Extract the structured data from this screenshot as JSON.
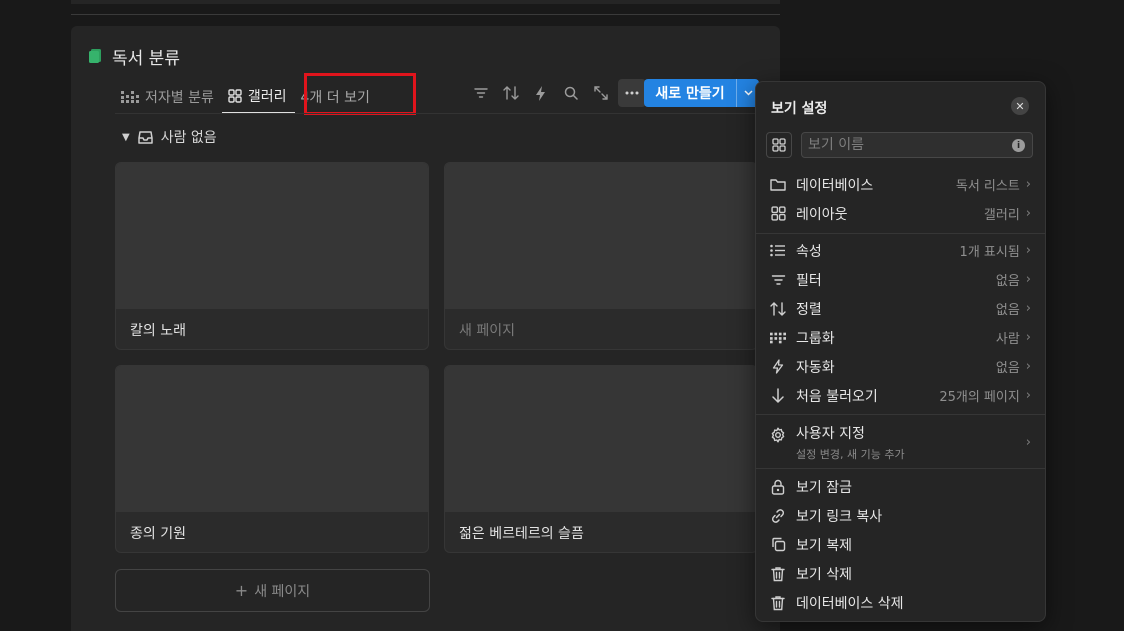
{
  "database": {
    "title": "독서 분류",
    "tabs": [
      {
        "label": "저자별 분류",
        "icon": "board-icon",
        "active": false
      },
      {
        "label": "갤러리",
        "icon": "gallery-icon",
        "active": true
      }
    ],
    "more_tabs": "4개 더 보기",
    "new_button": "새로 만들기",
    "group_label": "사람 없음",
    "cards": [
      "칼의 노래",
      "새 페이지",
      "종의 기원",
      "젊은 베르테르의 슬픔"
    ],
    "new_page": "새 페이지"
  },
  "settings": {
    "title": "보기 설정",
    "name_placeholder": "보기 이름",
    "rows": [
      {
        "label": "데이터베이스",
        "value": "독서 리스트"
      },
      {
        "label": "레이아웃",
        "value": "갤러리"
      },
      {
        "label": "속성",
        "value": "1개 표시됨"
      },
      {
        "label": "필터",
        "value": "없음"
      },
      {
        "label": "정렬",
        "value": "없음"
      },
      {
        "label": "그룹화",
        "value": "사람"
      },
      {
        "label": "자동화",
        "value": "없음"
      },
      {
        "label": "처음 불러오기",
        "value": "25개의 페이지"
      }
    ],
    "custom": {
      "label": "사용자 지정",
      "sub": "설정 변경, 새 기능 추가"
    },
    "actions": [
      "보기 잠금",
      "보기 링크 복사",
      "보기 복제",
      "보기 삭제",
      "데이터베이스 삭제"
    ]
  },
  "colors": {
    "accent": "#2383e2",
    "highlight": "#e0141c",
    "book_icon": "#2d9f5e"
  }
}
